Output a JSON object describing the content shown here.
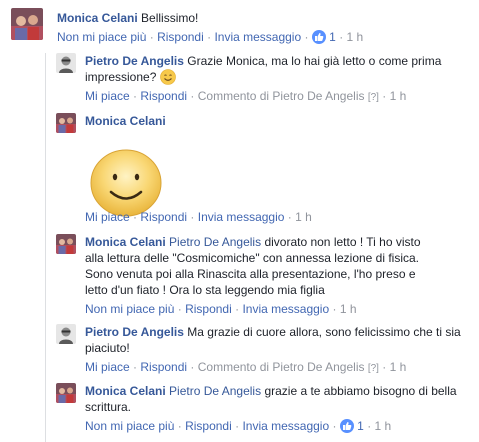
{
  "comments": [
    {
      "author": "Monica Celani",
      "text": "Bellissimo!",
      "actions": {
        "unlike": "Non mi piace più",
        "reply": "Rispondi",
        "message": "Invia messaggio",
        "likes": "1",
        "time": "1 h"
      }
    },
    {
      "author": "Pietro De Angelis",
      "text": "Grazie Monica, ma lo hai già letto o come prima impressione?",
      "actions": {
        "like": "Mi piace",
        "reply": "Rispondi",
        "comment_by": "Commento di Pietro De Angelis",
        "flag": "[?]",
        "time": "1 h"
      }
    },
    {
      "author": "Monica Celani",
      "sticker": "smiley-sticker",
      "actions": {
        "like": "Mi piace",
        "reply": "Rispondi",
        "message": "Invia messaggio",
        "time": "1 h"
      }
    },
    {
      "author": "Monica Celani",
      "mention": "Pietro De Angelis",
      "text_line1": "divorato non letto ! Ti ho visto",
      "text_line2": "alla lettura delle \"Cosmicomiche\" con annessa lezione di fisica.",
      "text_line3": "Sono venuta poi alla Rinascita alla presentazione, l'ho preso e",
      "text_line4": "letto d'un fiato ! Ora lo sta leggendo mia figlia",
      "actions": {
        "unlike": "Non mi piace più",
        "reply": "Rispondi",
        "message": "Invia messaggio",
        "time": "1 h"
      }
    },
    {
      "author": "Pietro De Angelis",
      "text": "Ma grazie di cuore allora, sono felicissimo che ti sia piaciuto!",
      "actions": {
        "like": "Mi piace",
        "reply": "Rispondi",
        "comment_by": "Commento di Pietro De Angelis",
        "flag": "[?]",
        "time": "1 h"
      }
    },
    {
      "author": "Monica Celani",
      "mention": "Pietro De Angelis",
      "text": "grazie a te abbiamo bisogno di bella scrittura.",
      "actions": {
        "unlike": "Non mi piace più",
        "reply": "Rispondi",
        "message": "Invia messaggio",
        "likes": "1",
        "time": "1 h"
      }
    }
  ],
  "separator": " · ",
  "colors": {
    "link": "#365899",
    "action": "#4267b2",
    "meta": "#90949c",
    "like_badge": "#5890ff"
  }
}
